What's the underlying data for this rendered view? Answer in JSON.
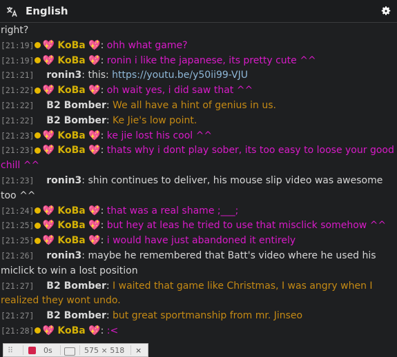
{
  "header": {
    "title": "English",
    "translate_icon": "translate-icon",
    "settings_icon": "gear-icon"
  },
  "chat": {
    "first_line": "right?",
    "messages": [
      {
        "time": "[21:19]",
        "user": "KoBa",
        "badge": true,
        "text": "ohh what game?",
        "kind": "koba"
      },
      {
        "time": "[21:19]",
        "user": "KoBa",
        "badge": true,
        "text": "ronin i like the japanese, its pretty cute ^^",
        "kind": "koba"
      },
      {
        "time": "[21:21]",
        "user": "ronin3",
        "badge": false,
        "text": "this: ",
        "link": "https://youtu.be/y50ii99-VJU",
        "kind": "ronin"
      },
      {
        "time": "[21:22]",
        "user": "KoBa",
        "badge": true,
        "text": "oh wait yes, i did saw that ^^",
        "kind": "koba"
      },
      {
        "time": "[21:22]",
        "user": "B2 Bomber",
        "badge": false,
        "text": "We all have a hint of genius in us.",
        "kind": "b2"
      },
      {
        "time": "[21:22]",
        "user": "B2 Bomber",
        "badge": false,
        "text": "Ke Jie's low point.",
        "kind": "b2"
      },
      {
        "time": "[21:23]",
        "user": "KoBa",
        "badge": true,
        "text": "ke jie lost his cool ^^",
        "kind": "koba"
      },
      {
        "time": "[21:23]",
        "user": "KoBa",
        "badge": true,
        "text": "thats why i dont play sober, its too easy to loose your good chill ^^",
        "kind": "koba"
      },
      {
        "time": "[21:23]",
        "user": "ronin3",
        "badge": false,
        "text": "shin continues to deliver, his mouse slip video was awesome too ^^",
        "kind": "ronin"
      },
      {
        "time": "[21:24]",
        "user": "KoBa",
        "badge": true,
        "text": "that was a real shame ;___;",
        "kind": "koba"
      },
      {
        "time": "[21:25]",
        "user": "KoBa",
        "badge": true,
        "text": "but hey at leas he tried to use that misclick somehow ^^",
        "kind": "koba"
      },
      {
        "time": "[21:25]",
        "user": "KoBa",
        "badge": true,
        "text": "i would have just abandoned it entirely",
        "kind": "koba"
      },
      {
        "time": "[21:26]",
        "user": "ronin3",
        "badge": false,
        "text": "maybe he remembered that Batt's video where he used his miclick to win a lost position",
        "kind": "ronin"
      },
      {
        "time": "[21:27]",
        "user": "B2 Bomber",
        "badge": false,
        "text": "I waited that game like Christmas, I was angry when I realized they wont undo.",
        "kind": "b2"
      },
      {
        "time": "[21:27]",
        "user": "B2 Bomber",
        "badge": false,
        "text": "but great sportmanship from mr. Jinseo",
        "kind": "b2"
      },
      {
        "time": "[21:28]",
        "user": "KoBa",
        "badge": true,
        "text": ":<",
        "kind": "koba"
      }
    ]
  },
  "toolbar": {
    "time": "0s",
    "dimensions": "575 × 518",
    "close": "×",
    "grip": "⠿"
  }
}
